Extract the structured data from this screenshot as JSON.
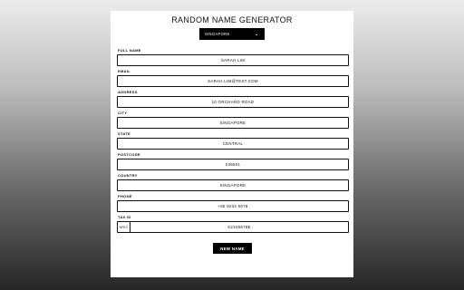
{
  "app": {
    "title": "RANDOM NAME GENERATOR",
    "country_selected": "SINGAPORE",
    "button_label": "NEW NAME"
  },
  "fields": {
    "full_name": {
      "label": "FULL NAME",
      "value": "SARAH LIM"
    },
    "email": {
      "label": "EMAIL",
      "value": "SARAH.LIM@TEST.COM"
    },
    "address": {
      "label": "ADDRESS",
      "value": "10 ORCHARD ROAD"
    },
    "city": {
      "label": "CITY",
      "value": "SINGAPORE"
    },
    "state": {
      "label": "STATE",
      "value": "CENTRAL"
    },
    "postcode": {
      "label": "POSTCODE",
      "value": "238801"
    },
    "country": {
      "label": "COUNTRY",
      "value": "SINGAPORE"
    },
    "phone": {
      "label": "PHONE",
      "value": "+65 9234 5678"
    },
    "tax_id": {
      "label": "TAX ID",
      "prefix": "NRIC",
      "value": "S2345678E"
    }
  },
  "icons": {
    "dropdown": "chevron-down-icon"
  },
  "colors": {
    "accent": "#000000",
    "card": "#ffffff"
  }
}
